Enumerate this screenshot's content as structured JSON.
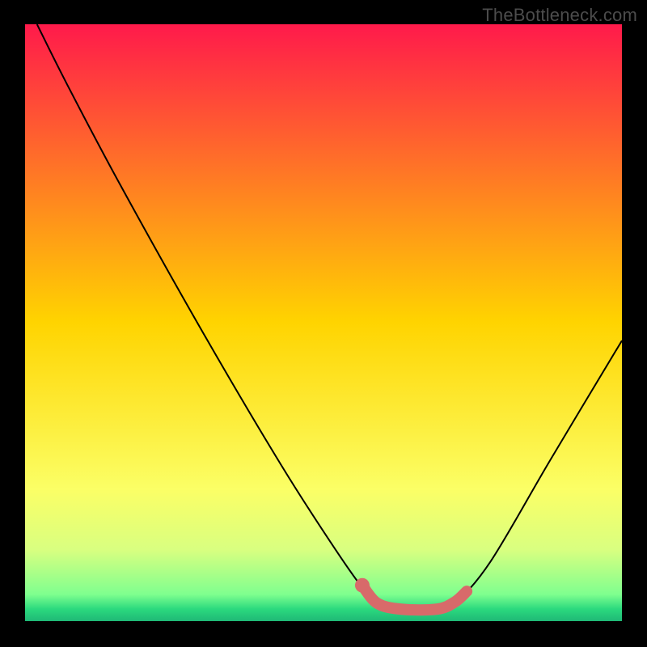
{
  "watermark": "TheBottleneck.com",
  "chart_data": {
    "type": "line",
    "title": "",
    "xlabel": "",
    "ylabel": "",
    "xlim": [
      0,
      100
    ],
    "ylim": [
      0,
      100
    ],
    "grid": false,
    "legend": false,
    "gradient_stops": [
      {
        "offset": 0.0,
        "color": "#ff1a4b"
      },
      {
        "offset": 0.5,
        "color": "#ffd400"
      },
      {
        "offset": 0.78,
        "color": "#fbff66"
      },
      {
        "offset": 0.88,
        "color": "#d9ff80"
      },
      {
        "offset": 0.955,
        "color": "#7fff8f"
      },
      {
        "offset": 0.98,
        "color": "#2bd97e"
      },
      {
        "offset": 1.0,
        "color": "#1fb876"
      }
    ],
    "series": [
      {
        "name": "bottleneck-curve",
        "stroke": "#000000",
        "stroke_width": 2,
        "points": [
          {
            "x": 2,
            "y": 100
          },
          {
            "x": 7,
            "y": 90
          },
          {
            "x": 16,
            "y": 73
          },
          {
            "x": 30,
            "y": 48
          },
          {
            "x": 43,
            "y": 26
          },
          {
            "x": 52,
            "y": 12
          },
          {
            "x": 57,
            "y": 5
          },
          {
            "x": 60,
            "y": 2.5
          },
          {
            "x": 63,
            "y": 2
          },
          {
            "x": 69,
            "y": 2
          },
          {
            "x": 72,
            "y": 3
          },
          {
            "x": 78,
            "y": 10
          },
          {
            "x": 88,
            "y": 27
          },
          {
            "x": 100,
            "y": 47
          }
        ]
      },
      {
        "name": "highlight-segment",
        "stroke": "#d86a6a",
        "stroke_width": 14,
        "points": [
          {
            "x": 56.5,
            "y": 6
          },
          {
            "x": 59,
            "y": 3
          },
          {
            "x": 63,
            "y": 2
          },
          {
            "x": 69,
            "y": 2
          },
          {
            "x": 72,
            "y": 3.2
          },
          {
            "x": 74,
            "y": 5
          }
        ]
      }
    ],
    "highlight_dot": {
      "x": 56.5,
      "y": 6,
      "r": 9,
      "fill": "#d86a6a"
    }
  }
}
